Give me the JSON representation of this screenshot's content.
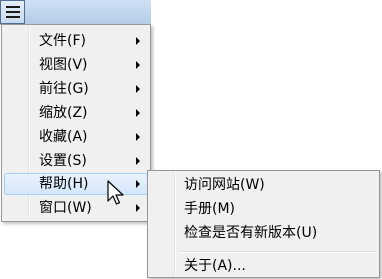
{
  "toolbar": {
    "menu_button_icon": "hamburger-menu-icon"
  },
  "main_menu": {
    "items": [
      {
        "label": "文件(F)",
        "has_submenu": true
      },
      {
        "label": "视图(V)",
        "has_submenu": true
      },
      {
        "label": "前往(G)",
        "has_submenu": true
      },
      {
        "label": "缩放(Z)",
        "has_submenu": true
      },
      {
        "label": "收藏(A)",
        "has_submenu": true
      },
      {
        "label": "设置(S)",
        "has_submenu": true
      },
      {
        "label": "帮助(H)",
        "has_submenu": true,
        "active": true
      },
      {
        "label": "窗口(W)",
        "has_submenu": true
      }
    ]
  },
  "help_submenu": {
    "items": [
      {
        "label": "访问网站(W)"
      },
      {
        "label": "手册(M)"
      },
      {
        "label": "检查是否有新版本(U)"
      },
      {
        "label": "关于(A)..."
      }
    ]
  },
  "cursor": {
    "icon": "mouse-pointer-icon"
  },
  "colors": {
    "menu_background": "#f0f0f0",
    "hover_background": "#d3e6fa",
    "hover_border": "#aacdf2",
    "toolbar_background": "#c9d9ec"
  }
}
